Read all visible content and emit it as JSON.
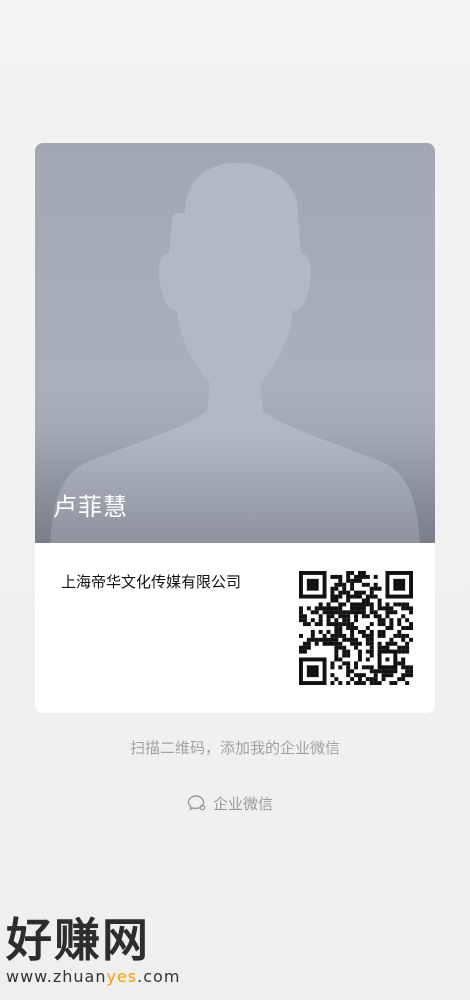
{
  "card": {
    "name": "卢菲慧",
    "company": "上海帝华文化传媒有限公司"
  },
  "hint": "扫描二维码，添加我的企业微信",
  "footer_link": {
    "label": "企业微信",
    "icon": "wework-icon"
  },
  "watermark": {
    "logo_text": "好赚网",
    "url_pre": "www.zhuan",
    "url_yes": "yes",
    "url_post": ".com"
  },
  "colors": {
    "background": "#f1f1f1",
    "photo_bg": "#a6adb9",
    "hint_text": "#a1a1a1",
    "watermark_accent": "#f6a000"
  }
}
